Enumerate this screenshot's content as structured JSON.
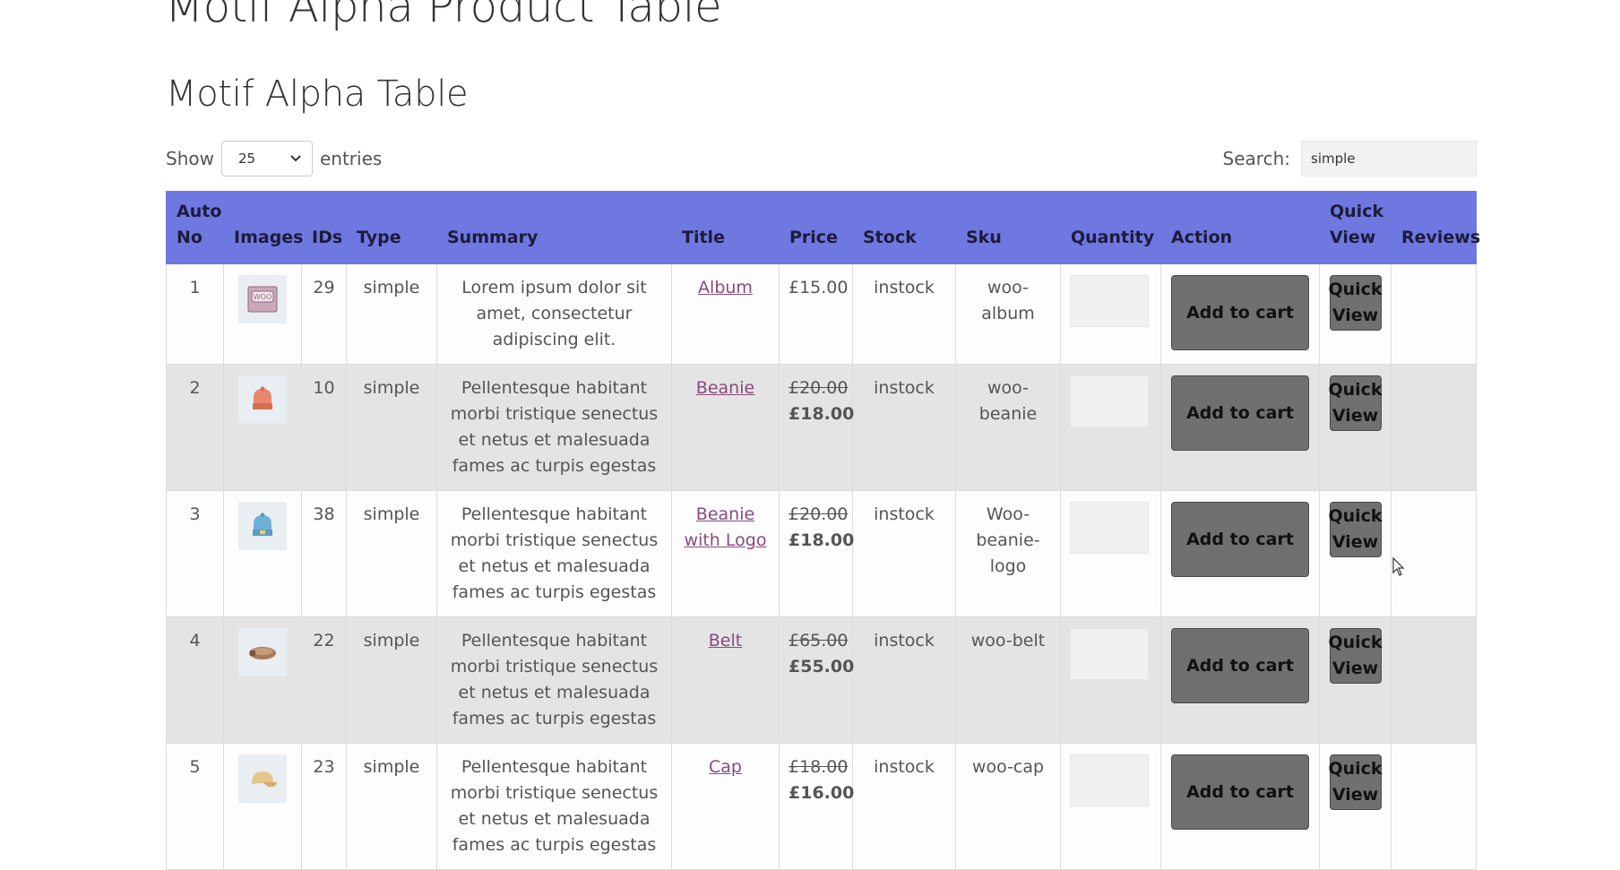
{
  "page": {
    "title": "Motif Alpha Product Table",
    "section_title": "Motif Alpha Table"
  },
  "controls": {
    "show_label": "Show",
    "entries_value": "25",
    "entries_label": "entries",
    "search_label": "Search:",
    "search_value": "simple"
  },
  "table": {
    "headers": {
      "auto_no": "Auto No",
      "images": "Images",
      "ids": "IDs",
      "type": "Type",
      "summary": "Summary",
      "title": "Title",
      "price": "Price",
      "stock": "Stock",
      "sku": "Sku",
      "quantity": "Quantity",
      "action": "Action",
      "quick_view": "Quick View",
      "reviews": "Reviews"
    },
    "add_to_cart_label": "Add to cart",
    "quick_view_label": "Quick View",
    "rows": [
      {
        "no": "1",
        "image": "album-icon",
        "id": "29",
        "type": "simple",
        "summary": "Lorem ipsum dolor sit amet, consectetur adipiscing elit.",
        "title": "Album",
        "price_old": "",
        "price": "£15.00",
        "stock": "instock",
        "sku": "woo-album"
      },
      {
        "no": "2",
        "image": "beanie-icon",
        "id": "10",
        "type": "simple",
        "summary": "Pellentesque habitant morbi tristique senectus et netus et malesuada fames ac turpis egestas",
        "title": "Beanie",
        "price_old": "£20.00",
        "price": "£18.00",
        "stock": "instock",
        "sku": "woo-beanie"
      },
      {
        "no": "3",
        "image": "beanie-logo-icon",
        "id": "38",
        "type": "simple",
        "summary": "Pellentesque habitant morbi tristique senectus et netus et malesuada fames ac turpis egestas",
        "title": "Beanie with Logo",
        "price_old": "£20.00",
        "price": "£18.00",
        "stock": "instock",
        "sku": "Woo-beanie-logo"
      },
      {
        "no": "4",
        "image": "belt-icon",
        "id": "22",
        "type": "simple",
        "summary": "Pellentesque habitant morbi tristique senectus et netus et malesuada fames ac turpis egestas",
        "title": "Belt",
        "price_old": "£65.00",
        "price": "£55.00",
        "stock": "instock",
        "sku": "woo-belt"
      },
      {
        "no": "5",
        "image": "cap-icon",
        "id": "23",
        "type": "simple",
        "summary": "Pellentesque habitant morbi tristique senectus et netus et malesuada fames ac turpis egestas",
        "title": "Cap",
        "price_old": "£18.00",
        "price": "£16.00",
        "stock": "instock",
        "sku": "woo-cap"
      }
    ]
  },
  "colors": {
    "header_bg": "#6e78e0",
    "link": "#8a4a7a",
    "button_bg": "#707070",
    "row_alt_bg": "#e4e4e4"
  },
  "icons": {
    "cursor": "arrow-cursor-icon",
    "select_chevron": "chevron-down-icon"
  }
}
